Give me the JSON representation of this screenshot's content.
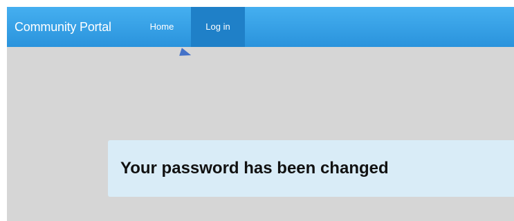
{
  "navbar": {
    "brand": "Community Portal",
    "items": [
      {
        "label": "Home",
        "active": false
      },
      {
        "label": "Log in",
        "active": true
      }
    ]
  },
  "alert": {
    "message": "Your password has been changed"
  },
  "colors": {
    "navbar": "#2a93dc",
    "navbar_active": "#1f80c8",
    "background": "#d6d6d6",
    "alert_background": "#d9ecf7",
    "cursor": "#4472c8"
  }
}
